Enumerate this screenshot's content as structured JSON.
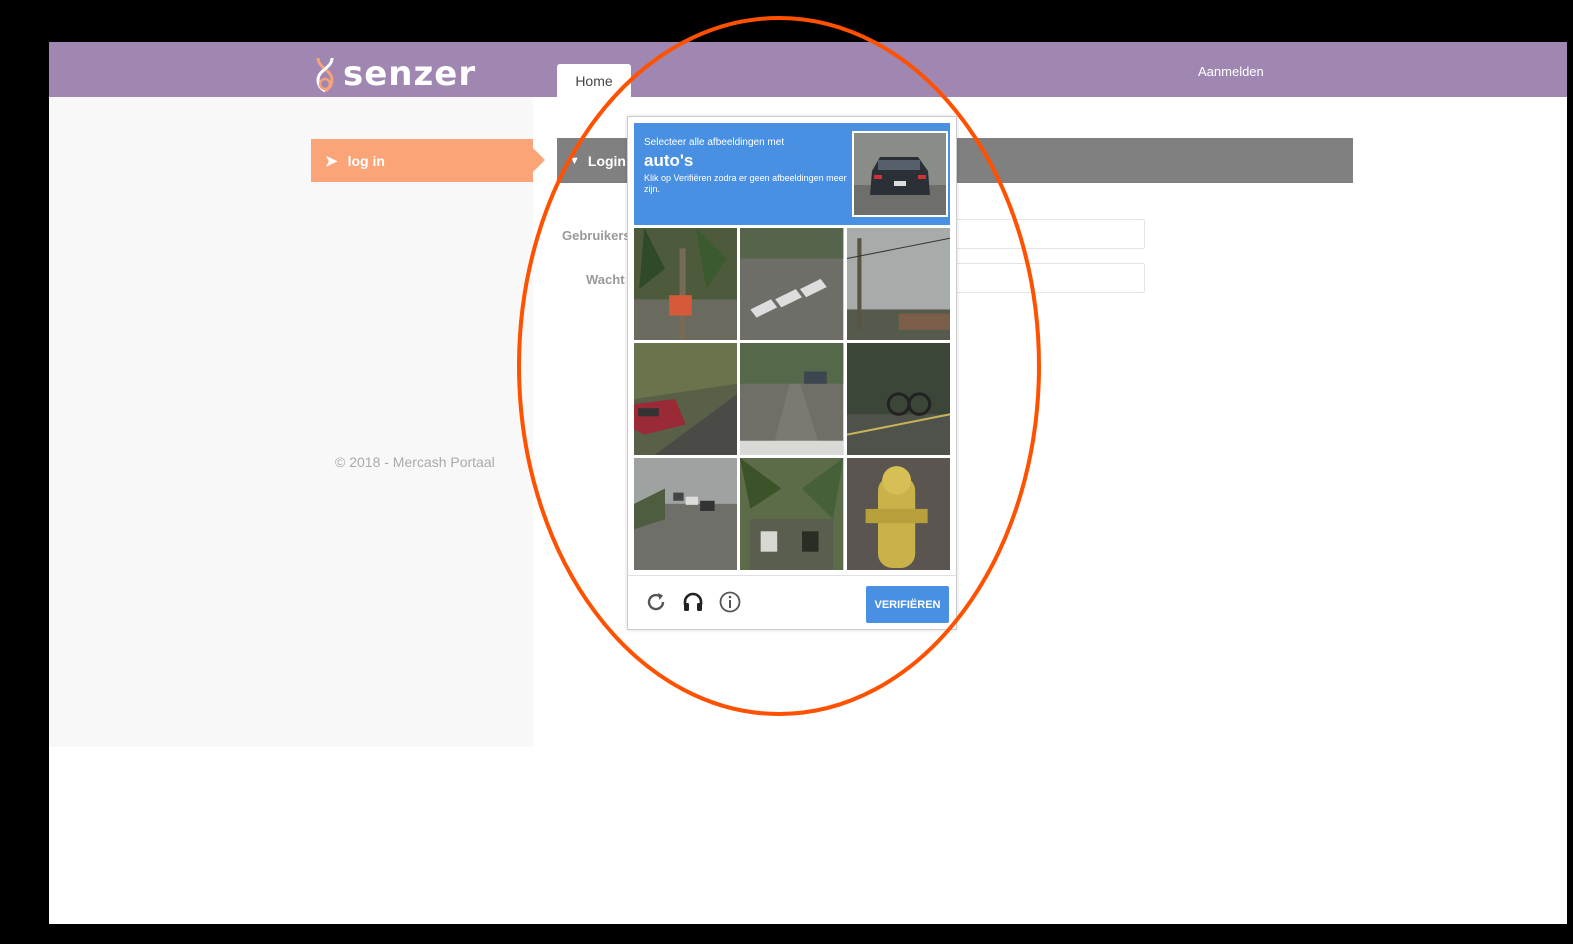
{
  "header": {
    "logo_text": "senzer",
    "tab_home": "Home",
    "login_link": "Aanmelden"
  },
  "sidebar": {
    "item_label": "log in",
    "copyright": "© 2018 - Mercash Portaal"
  },
  "main": {
    "panel_title": "Login",
    "username_label": "Gebruikers",
    "password_label": "Wacht"
  },
  "captcha": {
    "instruction": "Selecteer alle afbeeldingen met",
    "target": "auto's",
    "hint": "Klik op Verifiëren zodra er geen afbeeldingen meer zijn.",
    "verify_button": "VERIFIËREN",
    "icons": [
      "reload-icon",
      "audio-icon",
      "info-icon"
    ],
    "accent_color": "#4a90e2"
  },
  "colors": {
    "topbar": "#a087b1",
    "sidebar_active": "#fba477",
    "panel_header": "#808080",
    "annotation": "#ff5100"
  }
}
